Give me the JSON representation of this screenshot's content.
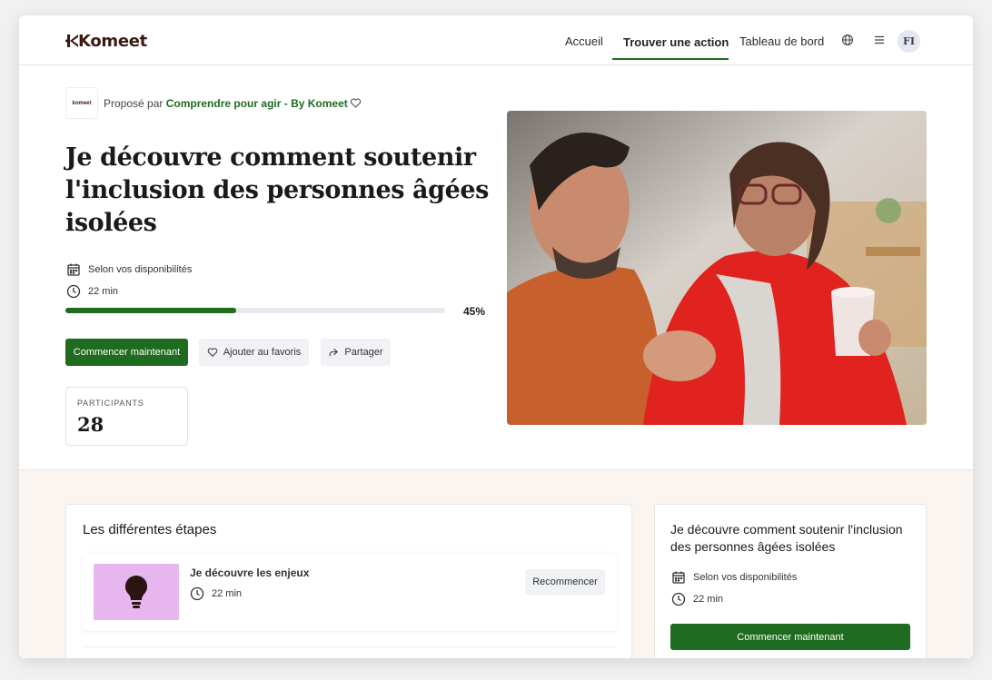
{
  "brand": {
    "logo_text": "Komeet",
    "org_logo_text": "komeet"
  },
  "nav": {
    "home": "Accueil",
    "find_action": "Trouver une action",
    "dashboard": "Tableau de bord",
    "avatar_initials": "FI"
  },
  "proposer": {
    "prefix": "Proposé par",
    "org": "Comprendre pour agir - By Komeet"
  },
  "action": {
    "title": "Je découvre comment soutenir l'inclusion des personnes âgées isolées",
    "availability": "Selon vos disponibilités",
    "duration": "22 min",
    "progress_percent": 45,
    "progress_label": "45%"
  },
  "buttons": {
    "start": "Commencer maintenant",
    "favorite": "Ajouter au favoris",
    "share": "Partager"
  },
  "participants": {
    "label": "PARTICIPANTS",
    "count": "28"
  },
  "steps": {
    "title": "Les différentes étapes",
    "items": [
      {
        "name": "Je découvre les enjeux",
        "duration": "22 min",
        "action": "Recommencer",
        "icon": "lightbulb-icon",
        "thumb_color": "#e7b6ee"
      }
    ]
  },
  "sidebar_card": {
    "title": "Je découvre comment soutenir l'inclusion des personnes âgées isolées",
    "availability": "Selon vos disponibilités",
    "duration": "22 min",
    "button": "Commencer maintenant"
  },
  "colors": {
    "primary": "#1f6b1f",
    "section_bg": "#fbf5f2",
    "brand_dark": "#3b1a15"
  },
  "icons": [
    "globe-icon",
    "menu-icon",
    "heart-icon",
    "calendar-icon",
    "clock-icon",
    "share-icon",
    "lightbulb-icon"
  ]
}
